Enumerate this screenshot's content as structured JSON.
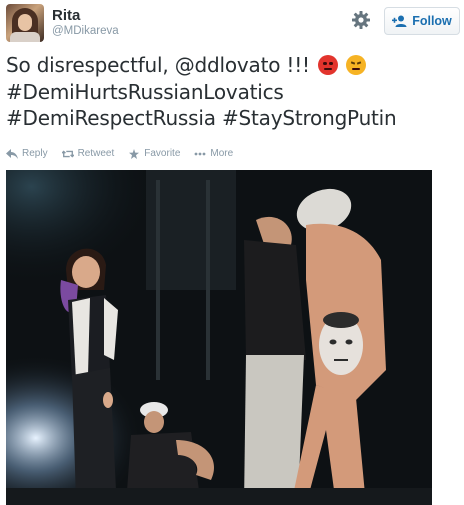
{
  "user": {
    "display_name": "Rita",
    "screen_name": "@MDikareva",
    "avatar_icon": "profile-photo"
  },
  "follow_button": {
    "label": "Follow",
    "icon": "add-user-icon"
  },
  "settings_icon": "gear-icon",
  "tweet": {
    "line1": "So disrespectful, @ddlovato !!! ",
    "line2": "#DemiHurtsRussianLovatics",
    "line3": "#DemiRespectRussia #StayStrongPutin",
    "emojis": [
      "angry-face-emoji",
      "triumph-face-emoji"
    ]
  },
  "actions": [
    {
      "label": "Reply",
      "icon": "reply-icon"
    },
    {
      "label": "Retweet",
      "icon": "retweet-icon"
    },
    {
      "label": "Favorite",
      "icon": "star-icon"
    },
    {
      "label": "More",
      "icon": "more-dots-icon"
    }
  ],
  "colors": {
    "text": "#292f33",
    "muted": "#8899a6",
    "link": "#1b6fb0",
    "angry_emoji": "#e2342d",
    "triumph_emoji": "#f6b324"
  }
}
